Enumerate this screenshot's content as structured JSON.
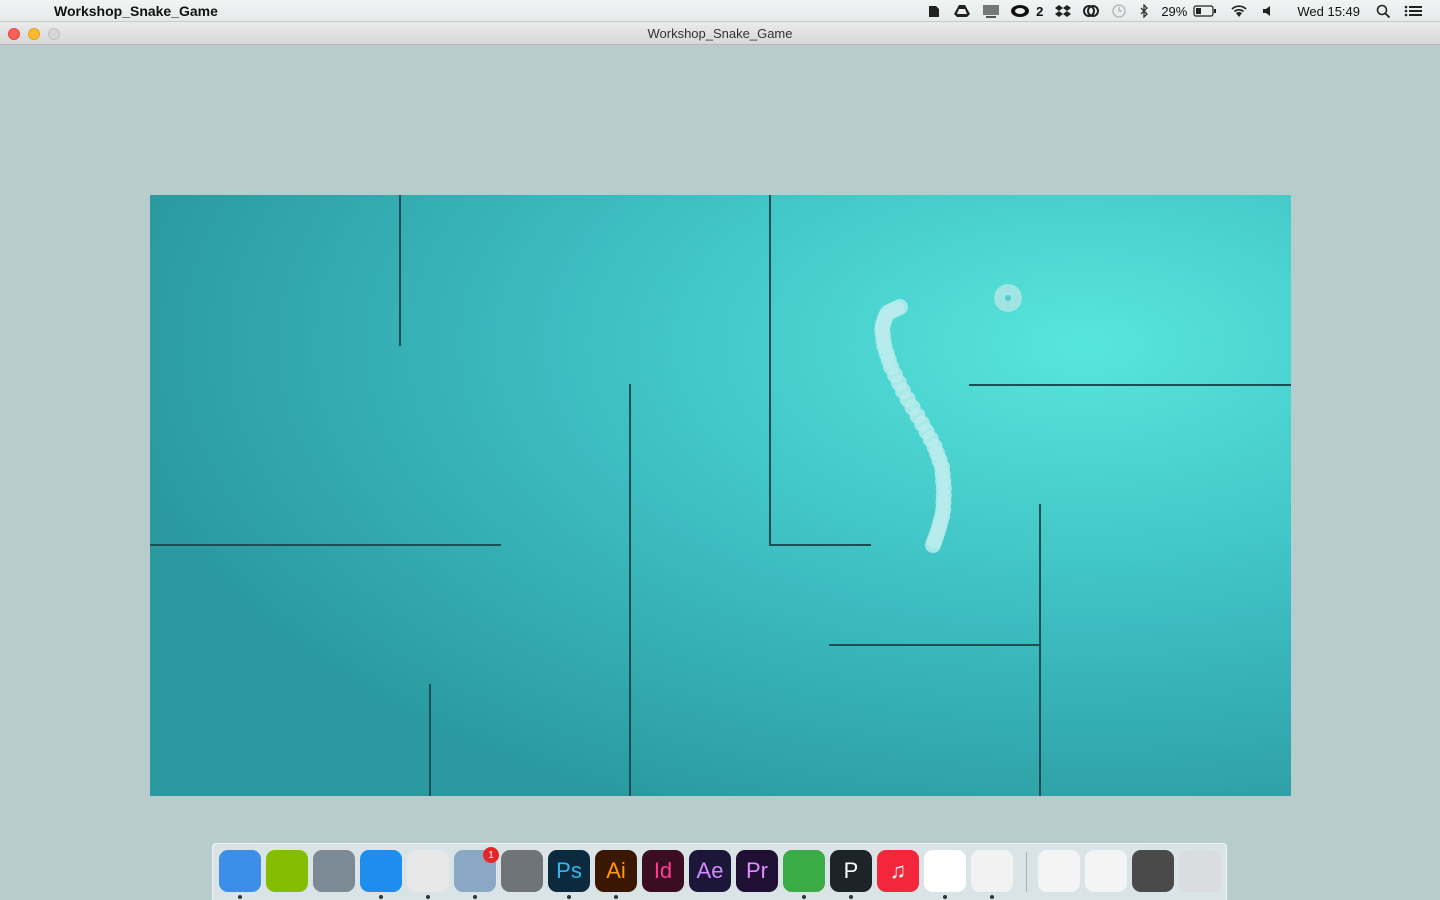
{
  "menubar": {
    "app_name": "Workshop_Snake_Game",
    "status_icons": [
      "evernote-icon",
      "google-drive-icon",
      "display-icon",
      "creative-cloud-icon",
      "dropbox-icon",
      "sync-icon",
      "time-machine-icon",
      "bluetooth-icon",
      "battery-icon",
      "wifi-icon",
      "volume-icon"
    ],
    "creative_cloud_count": "2",
    "battery_percent": "29%",
    "clock": "Wed 15:49"
  },
  "window": {
    "title": "Workshop_Snake_Game"
  },
  "game": {
    "colors": {
      "field_dark": "#2a9aa0",
      "field_light": "#57e6dc",
      "wall": "#1c4f55",
      "snake": "#b9ecec",
      "food": "#a9e6e6"
    },
    "snake_segment_count": 40
  },
  "dock": {
    "items": [
      {
        "name": "finder-icon",
        "label": "",
        "bg": "#3b8fe6"
      },
      {
        "name": "spotify-icon",
        "label": "",
        "bg": "#84bd00"
      },
      {
        "name": "launchpad-icon",
        "label": "",
        "bg": "#7c8a96"
      },
      {
        "name": "safari-icon",
        "label": "",
        "bg": "#1f8df0"
      },
      {
        "name": "chrome-icon",
        "label": "",
        "bg": "#e8e8e8"
      },
      {
        "name": "preview-icon",
        "label": "",
        "bg": "#8aa7c3",
        "badge": "1"
      },
      {
        "name": "system-preferences-icon",
        "label": "",
        "bg": "#6f7479"
      },
      {
        "name": "photoshop-icon",
        "label": "Ps",
        "bg": "#0c2a3d",
        "fg": "#36b7f0"
      },
      {
        "name": "illustrator-icon",
        "label": "Ai",
        "bg": "#3a1703",
        "fg": "#ff9a00"
      },
      {
        "name": "indesign-icon",
        "label": "Id",
        "bg": "#3a0d22",
        "fg": "#ff3c8e"
      },
      {
        "name": "after-effects-icon",
        "label": "Ae",
        "bg": "#1c1638",
        "fg": "#d08cff"
      },
      {
        "name": "premiere-icon",
        "label": "Pr",
        "bg": "#1e0f33",
        "fg": "#e68cff"
      },
      {
        "name": "evernote-icon",
        "label": "",
        "bg": "#3bab45"
      },
      {
        "name": "p-app-icon",
        "label": "P",
        "bg": "#1d2429",
        "fg": "#ffffff"
      },
      {
        "name": "itunes-icon",
        "label": "♫",
        "bg": "#f3263a",
        "fg": "#ffffff"
      },
      {
        "name": "acrobat-icon",
        "label": "",
        "bg": "#ffffff"
      },
      {
        "name": "java-icon",
        "label": "",
        "bg": "#f2f2f2"
      },
      {
        "name": "downloads-stack-icon",
        "label": "",
        "bg": "#f4f4f4"
      },
      {
        "name": "documents-stack-icon",
        "label": "",
        "bg": "#f4f4f4"
      },
      {
        "name": "screenshots-stack-icon",
        "label": "",
        "bg": "#4a4a4a"
      },
      {
        "name": "trash-icon",
        "label": "",
        "bg": "#d9dddf"
      }
    ]
  }
}
